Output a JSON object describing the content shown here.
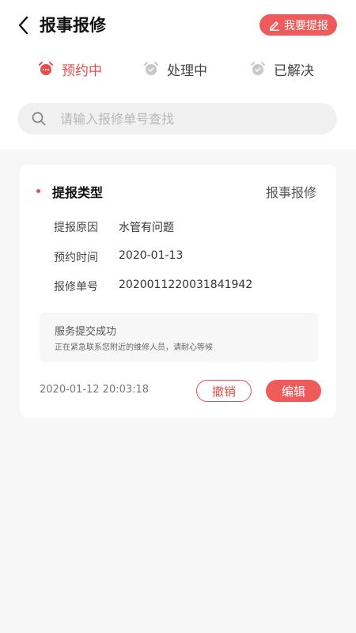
{
  "header": {
    "title": "报事报修",
    "report_label": "我要提报",
    "icons": {
      "back": "chevron-left-icon",
      "report": "pencil-icon"
    }
  },
  "tabs": [
    {
      "label": "预约中",
      "active": true,
      "icon": "alarm-clock-icon"
    },
    {
      "label": "处理中",
      "active": false,
      "icon": "alarm-clock-icon"
    },
    {
      "label": "已解决",
      "active": false,
      "icon": "alarm-clock-icon"
    }
  ],
  "search": {
    "placeholder": "请输入报修单号查找",
    "value": "",
    "icon": "search-icon"
  },
  "order": {
    "title": "提报类型",
    "type": "报事报修",
    "rows": [
      {
        "label": "提报原因",
        "value": "水管有问题"
      },
      {
        "label": "预约时间",
        "value": "2020-01-13"
      },
      {
        "label": "报修单号",
        "value": "2020011220031841942"
      }
    ],
    "notice_title": "服务提交成功",
    "notice_sub": "正在紧急联系您附近的维修人员，请耐心等候",
    "time": "2020-01-12 20:03:18",
    "cancel_label": "撤销",
    "edit_label": "编辑"
  },
  "colors": {
    "accent": "#ef5b5b",
    "active_tab": "#e84c4c",
    "inactive_icon": "#c8c8c8",
    "background": "#f7f7f7"
  }
}
